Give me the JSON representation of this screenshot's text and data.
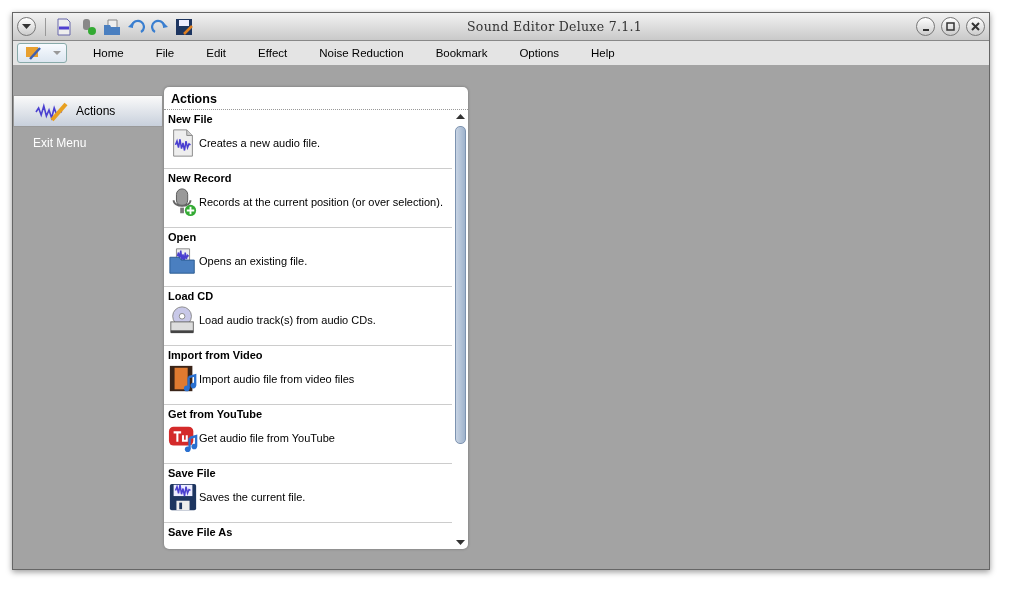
{
  "window": {
    "title": "Sound Editor Deluxe 7.1.1"
  },
  "menu": [
    "Home",
    "File",
    "Edit",
    "Effect",
    "Noise Reduction",
    "Bookmark",
    "Options",
    "Help"
  ],
  "sidebar": {
    "items": [
      {
        "label": "Actions",
        "selected": true
      },
      {
        "label": "Exit Menu",
        "selected": false
      }
    ]
  },
  "panel": {
    "title": "Actions",
    "items": [
      {
        "kind": "new",
        "title": "New File",
        "description": "Creates a new audio file."
      },
      {
        "kind": "record",
        "title": "New Record",
        "description": "Records at the current position (or over selection)."
      },
      {
        "kind": "open",
        "title": "Open",
        "description": "Opens an existing file."
      },
      {
        "kind": "cd",
        "title": "Load CD",
        "description": "Load audio track(s) from audio CDs."
      },
      {
        "kind": "video",
        "title": "Import from Video",
        "description": "Import audio file from video files"
      },
      {
        "kind": "youtube",
        "title": "Get from YouTube",
        "description": "Get audio file from YouTube"
      },
      {
        "kind": "save",
        "title": "Save File",
        "description": "Saves the current file."
      },
      {
        "title": "Save File As"
      }
    ]
  }
}
